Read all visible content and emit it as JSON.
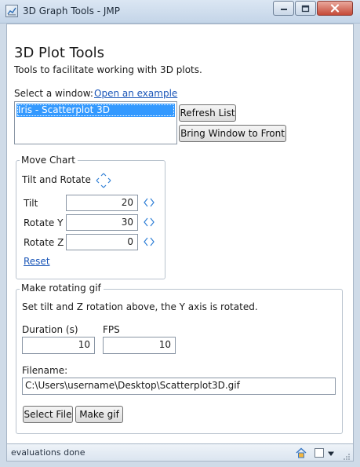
{
  "window": {
    "title": "3D Graph Tools - JMP"
  },
  "header": {
    "title": "3D Plot Tools",
    "subtitle": "Tools to facilitate working with 3D plots."
  },
  "window_select": {
    "label": "Select a window:",
    "example_link": "Open an example",
    "items": [
      "Iris - Scatterplot 3D"
    ],
    "refresh_label": "Refresh List",
    "bring_front_label": "Bring Window to Front"
  },
  "move_chart": {
    "legend": "Move Chart",
    "tilt_rotate_label": "Tilt and Rotate",
    "tilt_label": "Tilt",
    "tilt_value": "20",
    "rotate_y_label": "Rotate Y",
    "rotate_y_value": "30",
    "rotate_z_label": "Rotate Z",
    "rotate_z_value": "0",
    "reset_link": "Reset"
  },
  "gif": {
    "legend": "Make rotating gif",
    "note": "Set tilt and Z rotation above, the Y axis is rotated.",
    "duration_label": "Duration (s)",
    "duration_value": "10",
    "fps_label": "FPS",
    "fps_value": "10",
    "filename_label": "Filename:",
    "filename_value": "C:\\Users\\username\\Desktop\\Scatterplot3D.gif",
    "select_file_label": "Select File",
    "make_gif_label": "Make gif"
  },
  "status": {
    "text": "evaluations done"
  },
  "icons": {
    "app": "graph-icon",
    "minimize": "minimize-icon",
    "maximize": "maximize-icon",
    "close": "close-icon",
    "spinner": "spinner-arrows-icon",
    "home": "home-icon",
    "checkbox": "checkbox-icon",
    "dropdown": "dropdown-arrow-icon"
  },
  "colors": {
    "selection": "#3399ff",
    "link": "#1a56b8",
    "close_button": "#c54a38",
    "spinner": "#2f7fd6"
  }
}
